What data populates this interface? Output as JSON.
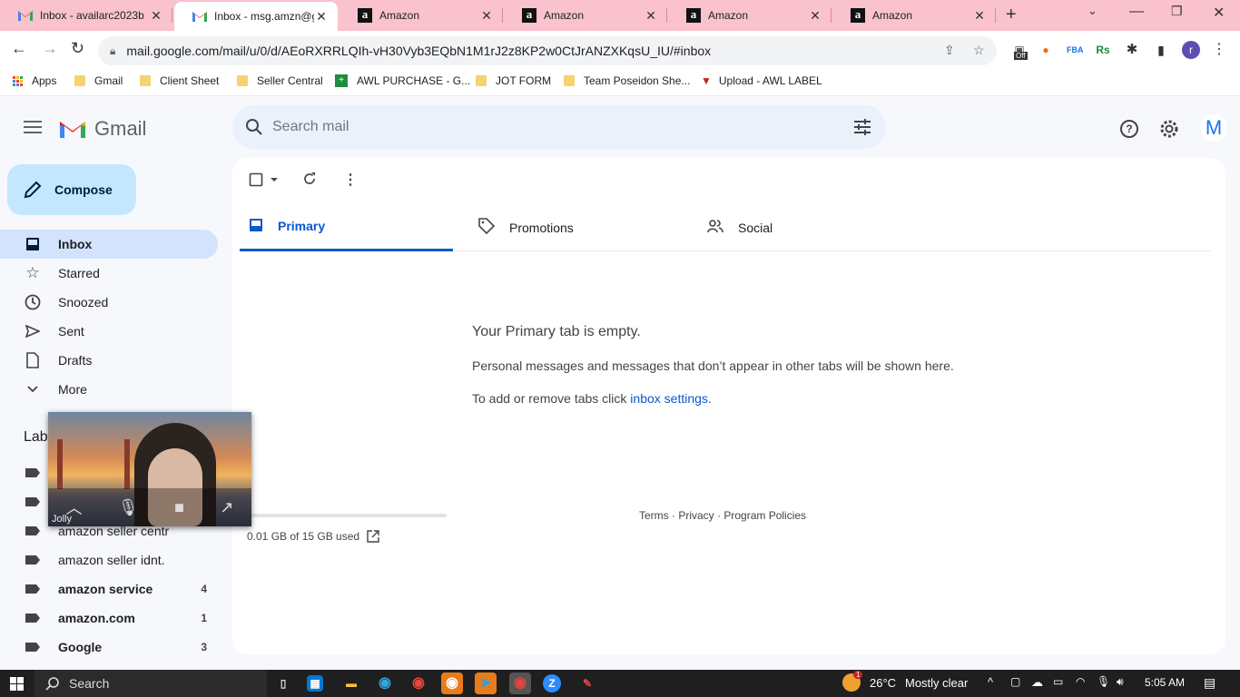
{
  "browser": {
    "tabs": [
      {
        "title": "Inbox - availarc2023b",
        "favicon": "gmail-icon"
      },
      {
        "title": "Inbox - msg.amzn@g",
        "favicon": "gmail-icon"
      },
      {
        "title": "Amazon",
        "favicon": "amazon-icon"
      },
      {
        "title": "Amazon",
        "favicon": "amazon-icon"
      },
      {
        "title": "Amazon",
        "favicon": "amazon-icon"
      },
      {
        "title": "Amazon",
        "favicon": "amazon-icon"
      }
    ],
    "active_tab": 1,
    "url": "mail.google.com/mail/u/0/d/AEoRXRRLQIh-vH30Vyb3EQbN1M1rJ2z8KP2w0CtJrANZXKqsU_IU/#inbox",
    "extension_badge": "Off",
    "profile_letter": "r",
    "bookmarks": [
      {
        "label": "Apps",
        "icon": "apps-grid-icon"
      },
      {
        "label": "Gmail",
        "icon": "folder-icon"
      },
      {
        "label": "Client Sheet",
        "icon": "folder-icon"
      },
      {
        "label": "Seller Central",
        "icon": "folder-icon"
      },
      {
        "label": "AWL PURCHASE - G...",
        "icon": "sheets-icon"
      },
      {
        "label": "JOT FORM",
        "icon": "folder-icon"
      },
      {
        "label": "Team Poseidon She...",
        "icon": "folder-icon"
      },
      {
        "label": "Upload - AWL LABEL",
        "icon": "triangle-icon"
      }
    ]
  },
  "gmail": {
    "brand": "Gmail",
    "search_placeholder": "Search mail",
    "avatar_letter": "M",
    "compose_label": "Compose",
    "nav": [
      {
        "label": "Inbox",
        "icon": "inbox-icon",
        "active": true
      },
      {
        "label": "Starred",
        "icon": "star-icon"
      },
      {
        "label": "Snoozed",
        "icon": "clock-icon"
      },
      {
        "label": "Sent",
        "icon": "send-icon"
      },
      {
        "label": "Drafts",
        "icon": "draft-icon"
      },
      {
        "label": "More",
        "icon": "chevron-down-icon"
      }
    ],
    "labels_heading": "Lab",
    "labels": [
      {
        "name": "",
        "count": ""
      },
      {
        "name": "",
        "count": ""
      },
      {
        "name": "amazon seller centr",
        "count": ""
      },
      {
        "name": "amazon seller idnt.",
        "count": ""
      },
      {
        "name": "amazon service",
        "count": "4",
        "bold": true
      },
      {
        "name": "amazon.com",
        "count": "1",
        "bold": true
      },
      {
        "name": "Google",
        "count": "3",
        "bold": true
      }
    ],
    "category_tabs": [
      {
        "label": "Primary",
        "icon": "inbox-icon",
        "active": true
      },
      {
        "label": "Promotions",
        "icon": "tag-icon"
      },
      {
        "label": "Social",
        "icon": "people-icon"
      }
    ],
    "empty": {
      "title": "Your Primary tab is empty.",
      "line1": "Personal messages and messages that don’t appear in other tabs will be shown here.",
      "line2_prefix": "To add or remove tabs click ",
      "line2_link": "inbox settings",
      "line2_suffix": "."
    },
    "storage": {
      "text": "0.01 GB of 15 GB used",
      "fraction": 0.0007
    },
    "footer": {
      "terms": "Terms",
      "privacy": "Privacy",
      "policies": "Program Policies",
      "sep": " · "
    }
  },
  "video_call": {
    "name": "Jolly"
  },
  "taskbar": {
    "search_label": "Search",
    "weather_temp": "26°C",
    "weather_desc": "Mostly clear",
    "time": "5:05 AM",
    "weather_badge": "1"
  }
}
